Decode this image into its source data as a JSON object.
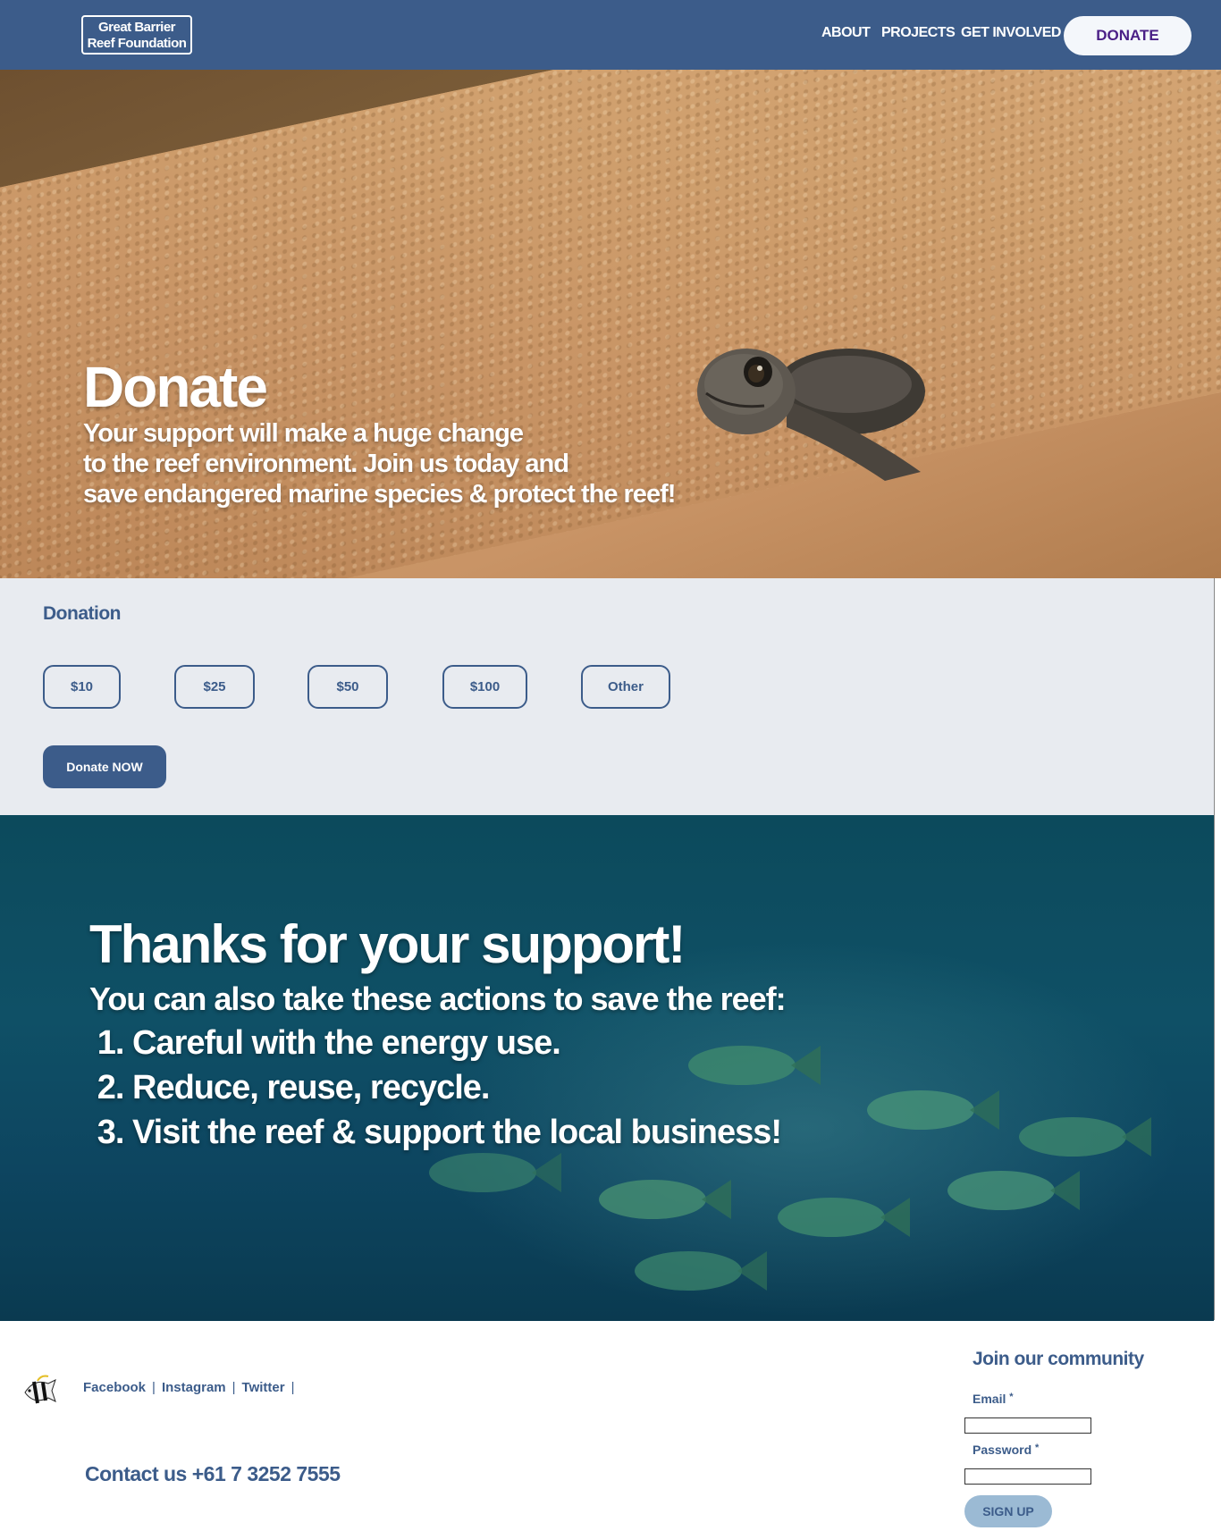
{
  "header": {
    "logo_line1": "Great Barrier",
    "logo_line2": "Reef Foundation",
    "nav": [
      "ABOUT",
      "PROJECTS",
      "GET INVOLVED"
    ],
    "donate_button": "DONATE"
  },
  "hero": {
    "title": "Donate",
    "subtitle_lines": [
      "Your support will make a huge change",
      "to the reef environment.  Join us today and",
      "save endangered marine species & protect the reef!"
    ]
  },
  "donation": {
    "heading": "Donation",
    "amounts": [
      "$10",
      "$25",
      "$50",
      "$100",
      "Other"
    ],
    "submit": "Donate NOW"
  },
  "thanks": {
    "title": "Thanks for your support!",
    "lead": "You can also take these actions to save the reef:",
    "actions": [
      "Careful with the energy use.",
      "Reduce, reuse, recycle.",
      "Visit the reef & support the local business!"
    ]
  },
  "footer": {
    "social": [
      "Facebook",
      "Instagram",
      "Twitter"
    ],
    "contact": "Contact us +61 7 3252 7555",
    "join_title": "Join our community",
    "email_label": "Email",
    "password_label": "Password",
    "required_mark": "*",
    "signup": "SIGN UP"
  }
}
